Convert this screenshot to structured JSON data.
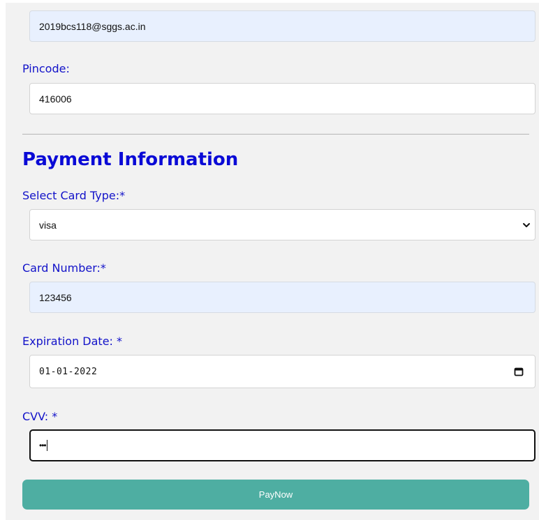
{
  "email": {
    "value": "2019bcs118@sggs.ac.in"
  },
  "pincode": {
    "label": "Pincode:",
    "value": "416006"
  },
  "payment": {
    "heading": "Payment Information",
    "card_type": {
      "label": "Select Card Type:*",
      "selected": "visa"
    },
    "card_number": {
      "label": "Card Number:*",
      "value": "123456"
    },
    "expiration": {
      "label": "Expiration Date: *",
      "value": "01-01-2022"
    },
    "cvv": {
      "label": "CVV: *",
      "masked_value": "•••"
    },
    "pay_button_label": "PayNow"
  },
  "icons": {
    "select_arrow": "chevron-down-icon",
    "date_picker": "calendar-icon"
  },
  "colors": {
    "label_text": "#1212c9",
    "heading_text": "#0a0ad6",
    "autofill_background": "#e8f0fe",
    "panel_background": "#f2f2f2",
    "pay_button": "#4eaea2"
  }
}
